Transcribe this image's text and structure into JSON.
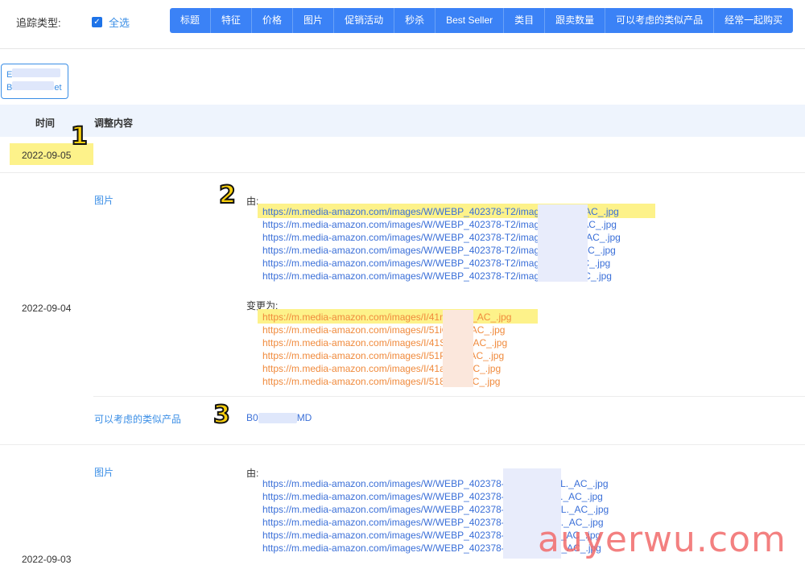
{
  "filter": {
    "track_label": "追踪类型:",
    "select_all_label": "全选",
    "check_glyph": "✓",
    "tabs": [
      "标题",
      "特征",
      "价格",
      "图片",
      "促销活动",
      "秒杀",
      "Best Seller",
      "类目",
      "跟卖数量",
      "可以考虑的类似产品",
      "经常一起购买"
    ]
  },
  "asin": {
    "line1": "E",
    "line2": "B",
    "line2_tail": "et"
  },
  "table": {
    "col_time": "时间",
    "col_content": "调整内容"
  },
  "rows": {
    "r1_date": "2022-09-05",
    "r2_date": "2022-09-04",
    "r3_date": "2022-09-03"
  },
  "change1": {
    "field": "图片",
    "from_label": "由:",
    "old_urls": [
      "https://m.media-amazon.com/images/W/WEBP_402378-T2/images/I                    pmL._AC_.jpg",
      "https://m.media-amazon.com/images/W/WEBP_402378-T2/images/I                    TqL._AC_.jpg",
      "https://m.media-amazon.com/images/W/WEBP_402378-T2/images/I                    WZL._AC_.jpg",
      "https://m.media-amazon.com/images/W/WEBP_402378-T2/images/I                    NrL._AC_.jpg",
      "https://m.media-amazon.com/images/W/WEBP_402378-T2/images/I                    JL._AC_.jpg",
      "https://m.media-amazon.com/images/W/WEBP_402378-T2/images/I                    YL._AC_.jpg"
    ],
    "to_label": "变更为:",
    "new_urls": [
      "https://m.media-amazon.com/images/I/41m2             mL._AC_.jpg",
      "https://m.media-amazon.com/images/I/51iO             gL._AC_.jpg",
      "https://m.media-amazon.com/images/I/41Ss             ZL._AC_.jpg",
      "https://m.media-amazon.com/images/I/51Pl             7L._AC_.jpg",
      "https://m.media-amazon.com/images/I/41a9             L._AC_.jpg",
      "https://m.media-amazon.com/images/I/518c             L._AC_.jpg"
    ]
  },
  "change2": {
    "field": "可以考虑的类似产品",
    "value_start": "B0",
    "value_end": "MD"
  },
  "change3": {
    "field": "图片",
    "from_label": "由:",
    "old_urls": [
      "https://m.media-amazon.com/images/W/WEBP_402378-T1                    23QjmpmL._AC_.jpg",
      "https://m.media-amazon.com/images/W/WEBP_402378-T1                    FQkCTqL._AC_.jpg",
      "https://m.media-amazon.com/images/W/WEBP_402378-T1                    sgK87WZL._AC_.jpg",
      "https://m.media-amazon.com/images/W/WEBP_402378-T1                    OHeHNrL._AC_.jpg",
      "https://m.media-amazon.com/images/W/WEBP_402378-T1                    lc7uaBJL._AC_.jpg",
      "https://m.media-amazon.com/images/W/WEBP_402378-T1                    xxYOcYL._AC_.jpg"
    ]
  },
  "annotations": [
    "1",
    "2",
    "3"
  ],
  "watermark": "auyerwu.com",
  "colors": {
    "accent": "#3b82f6",
    "highlight": "#fdf28a",
    "new_url": "#f08a3c",
    "old_url": "#3a6fd8"
  }
}
